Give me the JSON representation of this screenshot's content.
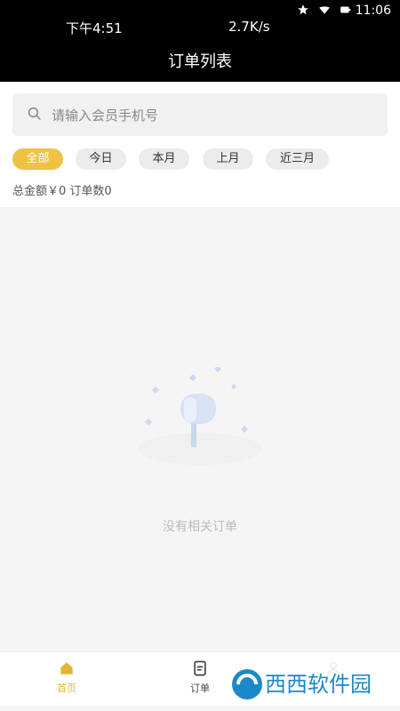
{
  "status_bar": {
    "left_time": "下午4:51",
    "network_speed": "2.7K/s",
    "right_time": "11:06",
    "battery": "39"
  },
  "header": {
    "title": "订单列表"
  },
  "search": {
    "placeholder": "请输入会员手机号",
    "value": ""
  },
  "filters": {
    "all": "全部",
    "today": "今日",
    "this_month": "本月",
    "last_month": "上月",
    "last_three_months": "近三月",
    "active": "all"
  },
  "summary": {
    "text": "总金额￥0 订单数0"
  },
  "empty_state": {
    "message": "没有相关订单"
  },
  "bottom_nav": {
    "home": "首页",
    "orders": "订单"
  },
  "watermark": {
    "text": "西西软件园"
  },
  "colors": {
    "accent": "#efc245",
    "active_nav": "#e2b437"
  }
}
